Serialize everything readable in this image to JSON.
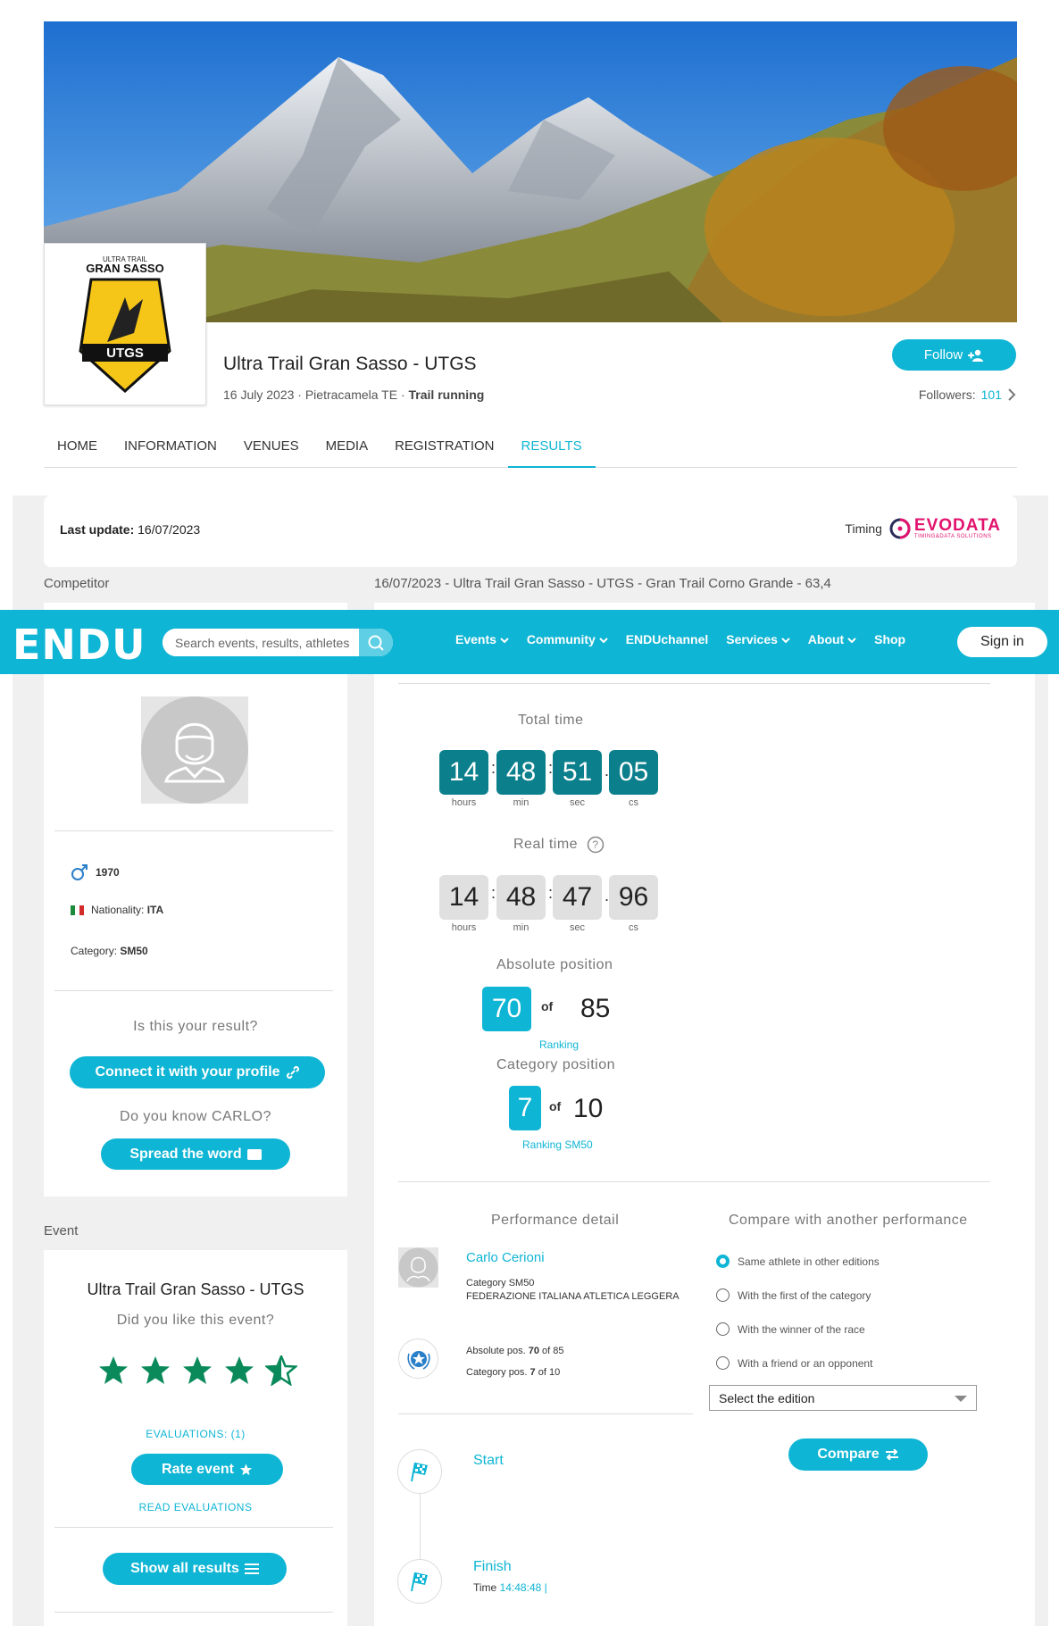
{
  "event": {
    "title": "Ultra Trail Gran Sasso - UTGS",
    "date_place": "16 July 2023 · Pietracamela TE · ",
    "discipline": "Trail running",
    "follow_label": "Follow",
    "followers_label": "Followers:",
    "followers_count": "101",
    "logo_text_small": "ULTRA TRAIL",
    "logo_text_big": "GRAN SASSO",
    "logo_badge": "UTGS"
  },
  "nav": [
    "HOME",
    "INFORMATION",
    "VENUES",
    "MEDIA",
    "REGISTRATION",
    "RESULTS"
  ],
  "update": {
    "label": "Last update:",
    "date": "16/07/2023",
    "timing_label": "Timing",
    "timing_brand": "EVODATA",
    "timing_tagline": "TIMING&DATA SOLUTIONS"
  },
  "section_labels": {
    "competitor": "Competitor",
    "race": "16/07/2023 - Ultra Trail Gran Sasso - UTGS - Gran Trail Corno Grande - 63,4",
    "event": "Event"
  },
  "header": {
    "logo": "ENDU",
    "search_placeholder": "Search events, results, athletes",
    "menu": [
      "Events",
      "Community",
      "ENDUchannel",
      "Services",
      "About",
      "Shop"
    ],
    "menu_dropdown": [
      true,
      true,
      false,
      true,
      true,
      false
    ],
    "sign_in": "Sign in"
  },
  "athlete": {
    "birth_year": "1970",
    "nationality_label": "Nationality:",
    "nationality": "ITA",
    "category_label": "Category:",
    "category": "SM50",
    "question": "Is this your result?",
    "connect_label": "Connect it with your profile",
    "know_question": "Do you know CARLO?",
    "spread_label": "Spread the word"
  },
  "event_card": {
    "title": "Ultra Trail Gran Sasso - UTGS",
    "like_question": "Did you like this event?",
    "rating": 4.5,
    "evaluations": "EVALUATIONS: (1)",
    "rate_label": "Rate event",
    "read_label": "READ EVALUATIONS",
    "show_all_label": "Show all results"
  },
  "results": {
    "total_time_label": "Total time",
    "total_time": [
      "14",
      "48",
      "51",
      "05"
    ],
    "real_time_label": "Real time",
    "real_time": [
      "14",
      "48",
      "47",
      "96"
    ],
    "units": [
      "hours",
      "min",
      "sec",
      "cs"
    ],
    "abs_label": "Absolute position",
    "abs_pos": "70",
    "abs_total": "85",
    "of": "of",
    "ranking_label": "Ranking",
    "cat_label": "Category position",
    "cat_pos": "7",
    "cat_total": "10",
    "ranking_cat_label": "Ranking SM50"
  },
  "performance": {
    "title": "Performance detail",
    "name": "Carlo Cerioni",
    "category_line": "Category SM50",
    "federation": "FEDERAZIONE ITALIANA ATLETICA LEGGERA",
    "abs_prefix": "Absolute pos.",
    "abs_value": "70",
    "abs_of": "of 85",
    "cat_prefix": "Category pos.",
    "cat_value": "7",
    "cat_of": "of 10"
  },
  "compare": {
    "title": "Compare with another performance",
    "options": [
      "Same athlete in other editions",
      "With the first of the category",
      "With the winner of the race",
      "With a friend or an opponent"
    ],
    "selected": 0,
    "select_label": "Select the edition",
    "button": "Compare"
  },
  "stages": {
    "start": "Start",
    "finish": "Finish",
    "time_label": "Time",
    "time_value": "14:48:48 |"
  },
  "colors": {
    "accent": "#0fb5d4",
    "time_dark": "#0b7f8c",
    "star": "#0a8a5a"
  }
}
